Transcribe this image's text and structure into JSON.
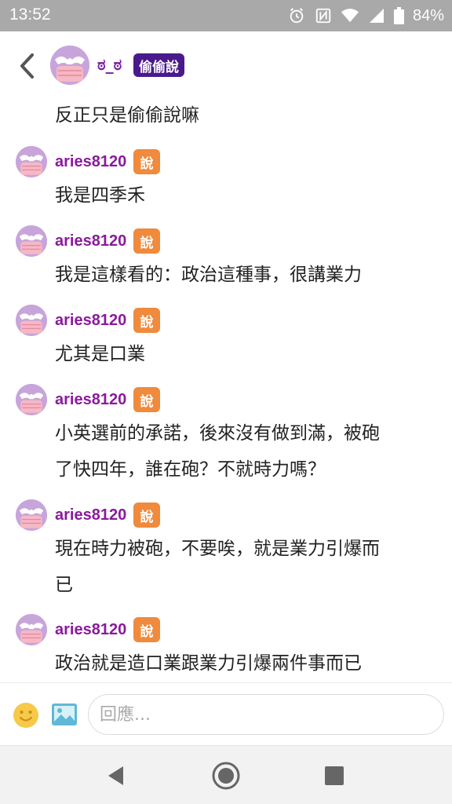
{
  "status_bar": {
    "time": "13:52",
    "battery": "84%",
    "icons": [
      "alarm-icon",
      "nfc-icon",
      "wifi-icon",
      "signal-icon",
      "battery-icon"
    ]
  },
  "header": {
    "back_icon": "chevron-left-icon",
    "username": "ಠ_ಠ",
    "badge": "偷偷說",
    "post_text": "反正只是偷偷說嘛"
  },
  "comments": [
    {
      "user": "aries8120",
      "badge": "說",
      "lines": [
        "我是四季禾"
      ]
    },
    {
      "user": "aries8120",
      "badge": "說",
      "lines": [
        "我是這樣看的：政治這種事，很講業力"
      ]
    },
    {
      "user": "aries8120",
      "badge": "說",
      "lines": [
        "尤其是口業"
      ]
    },
    {
      "user": "aries8120",
      "badge": "說",
      "lines": [
        "小英選前的承諾，後來沒有做到滿，被砲",
        "了快四年，誰在砲？不就時力嗎？"
      ]
    },
    {
      "user": "aries8120",
      "badge": "說",
      "lines": [
        "現在時力被砲，不要唉，就是業力引爆而",
        "已"
      ]
    },
    {
      "user": "aries8120",
      "badge": "說",
      "lines": [
        "政治就是造口業跟業力引爆兩件事而已"
      ]
    }
  ],
  "reply_bar": {
    "emoji_icon": "smiley-icon",
    "image_icon": "image-icon",
    "placeholder": "回應..."
  },
  "nav_bar": {
    "icons": [
      "back-triangle-icon",
      "home-circle-icon",
      "recents-square-icon"
    ]
  },
  "colors": {
    "status_bar": "#a9a9a9",
    "username": "#8a1a9c",
    "badge_purple": "#4a1a8c",
    "badge_orange": "#f08a3c",
    "avatar_bg": "#c7a5db"
  }
}
